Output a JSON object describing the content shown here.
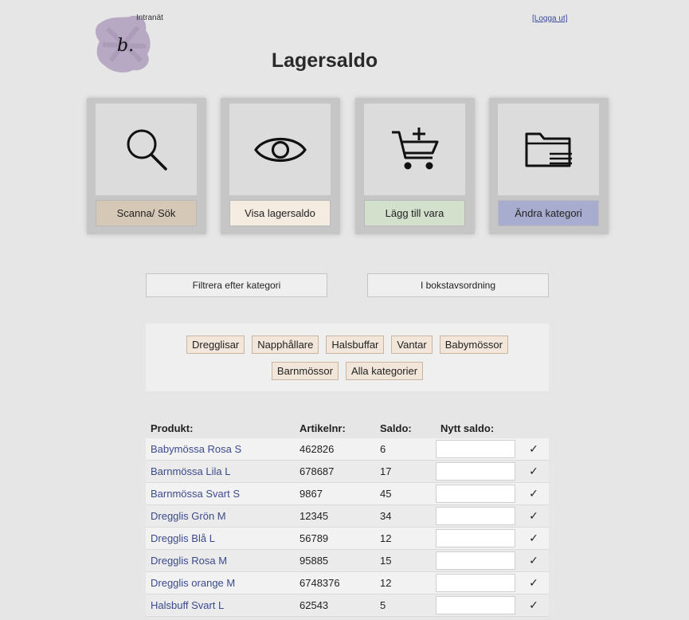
{
  "header": {
    "logo_letter": "b.",
    "logo_label": "Intranät",
    "logout": "[Logga ut]",
    "title": "Lagersaldo"
  },
  "tiles": [
    {
      "label": "Scanna/ Sök",
      "icon": "search-icon",
      "color": "#d6c8b6"
    },
    {
      "label": "Visa lagersaldo",
      "icon": "eye-icon",
      "color": "#f4ebe1"
    },
    {
      "label": "Lägg till vara",
      "icon": "add-to-cart-icon",
      "color": "#d2e0cc"
    },
    {
      "label": "Ändra kategori",
      "icon": "folder-icon",
      "color": "#a8add0"
    }
  ],
  "filters": {
    "by_category": "Filtrera efter kategori",
    "alphabetical": "I bokstavsordning"
  },
  "categories": [
    "Dregglisar",
    "Napphållare",
    "Halsbuffar",
    "Vantar",
    "Babymössor",
    "Barnmössor",
    "Alla kategorier"
  ],
  "table": {
    "headers": [
      "Produkt:",
      "Artikelnr:",
      "Saldo:",
      "Nytt saldo:"
    ],
    "check_symbol": "✓",
    "rows": [
      {
        "product": "Babymössa Rosa S",
        "article": "462826",
        "stock": "6"
      },
      {
        "product": "Barnmössa Lila L",
        "article": "678687",
        "stock": "17"
      },
      {
        "product": "Barnmössa Svart S",
        "article": "9867",
        "stock": "45"
      },
      {
        "product": "Dregglis Grön M",
        "article": "12345",
        "stock": "34"
      },
      {
        "product": "Dregglis Blå L",
        "article": "56789",
        "stock": "12"
      },
      {
        "product": "Dregglis Rosa M",
        "article": "95885",
        "stock": "15"
      },
      {
        "product": "Dregglis orange M",
        "article": "6748376",
        "stock": "12"
      },
      {
        "product": "Halsbuff Svart L",
        "article": "62543",
        "stock": "5"
      }
    ]
  },
  "colors": {
    "background": "#e6e6e6",
    "logo": "#b7a8c4",
    "link": "#3c4a8c"
  }
}
